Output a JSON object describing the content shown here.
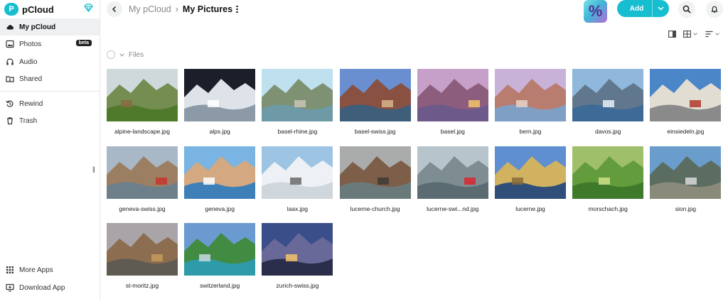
{
  "brand": {
    "name": "pCloud",
    "mark": "P"
  },
  "nav": {
    "my_pcloud": "My pCloud",
    "photos": "Photos",
    "photos_badge": "beta",
    "audio": "Audio",
    "shared": "Shared",
    "rewind": "Rewind",
    "trash": "Trash",
    "more_apps": "More Apps",
    "download_app": "Download App"
  },
  "breadcrumb": {
    "root": "My pCloud",
    "separator": "›",
    "current": "My Pictures"
  },
  "header": {
    "add_label": "Add",
    "promo_glyph": "%"
  },
  "section": {
    "label": "Files"
  },
  "colors": {
    "accent": "#17bed0",
    "badge": "#222222"
  },
  "files": [
    {
      "name": "alpine-landscape.jpg",
      "sky": "#cfd9dc",
      "mid": "#6f8a4a",
      "low": "#4f7a2c",
      "accent": "#8b6a45"
    },
    {
      "name": "alps.jpg",
      "sky": "#1a1f2a",
      "mid": "#e9eef3",
      "low": "#8b9aa6",
      "accent": "#ffffff"
    },
    {
      "name": "basel-rhine.jpg",
      "sky": "#bfe0ef",
      "mid": "#7a8c6a",
      "low": "#6e9aa8",
      "accent": "#c9c3b5"
    },
    {
      "name": "basel-swiss.jpg",
      "sky": "#6a8fd0",
      "mid": "#8a4e3a",
      "low": "#3e5e7a",
      "accent": "#d7b48a"
    },
    {
      "name": "basel.jpg",
      "sky": "#c6a0c8",
      "mid": "#8a5a7a",
      "low": "#6d5a8a",
      "accent": "#f2c46a"
    },
    {
      "name": "bern.jpg",
      "sky": "#c9b2d8",
      "mid": "#b87a6a",
      "low": "#7f9fc4",
      "accent": "#e6d2c8"
    },
    {
      "name": "davos.jpg",
      "sky": "#8fb8dc",
      "mid": "#5e7388",
      "low": "#3d6a96",
      "accent": "#e8eef4"
    },
    {
      "name": "einsiedeln.jpg",
      "sky": "#4b86c8",
      "mid": "#e9e2d4",
      "low": "#8a8a8a",
      "accent": "#b23a2a"
    },
    {
      "name": "geneva-swiss.jpg",
      "sky": "#a9b8c6",
      "mid": "#9b7a5e",
      "low": "#6e7f8c",
      "accent": "#c8352e"
    },
    {
      "name": "geneva.jpg",
      "sky": "#7ab4e2",
      "mid": "#d9a87a",
      "low": "#3f7fb8",
      "accent": "#ffffff"
    },
    {
      "name": "laax.jpg",
      "sky": "#9ec4e4",
      "mid": "#f1f3f5",
      "low": "#cfd6dc",
      "accent": "#6a6a6a"
    },
    {
      "name": "lucerne-church.jpg",
      "sky": "#a9acab",
      "mid": "#7a5a42",
      "low": "#6a7a7a",
      "accent": "#3e3a35"
    },
    {
      "name": "lucerne-swi...nd.jpg",
      "sky": "#b7c4cc",
      "mid": "#7a8a8e",
      "low": "#5b6b72",
      "accent": "#d8262d"
    },
    {
      "name": "lucerne.jpg",
      "sky": "#5f8fd0",
      "mid": "#d7b45a",
      "low": "#2f4f7a",
      "accent": "#8a6a3a"
    },
    {
      "name": "morschach.jpg",
      "sky": "#9fbf6a",
      "mid": "#5f9a3a",
      "low": "#3f7a2a",
      "accent": "#cfe08a"
    },
    {
      "name": "sion.jpg",
      "sky": "#6a9ccc",
      "mid": "#5a6a5a",
      "low": "#8a8a7a",
      "accent": "#d9d9d9"
    },
    {
      "name": "st-moritz.jpg",
      "sky": "#a9a4a8",
      "mid": "#8a6a4a",
      "low": "#5f5a52",
      "accent": "#c79a5a"
    },
    {
      "name": "switzerland.jpg",
      "sky": "#6a9ad0",
      "mid": "#3f8a3a",
      "low": "#2f9aaa",
      "accent": "#c8d8e0"
    },
    {
      "name": "zurich-swiss.jpg",
      "sky": "#3a4e8a",
      "mid": "#6a6a9a",
      "low": "#2a2e4a",
      "accent": "#f2c46a"
    }
  ]
}
